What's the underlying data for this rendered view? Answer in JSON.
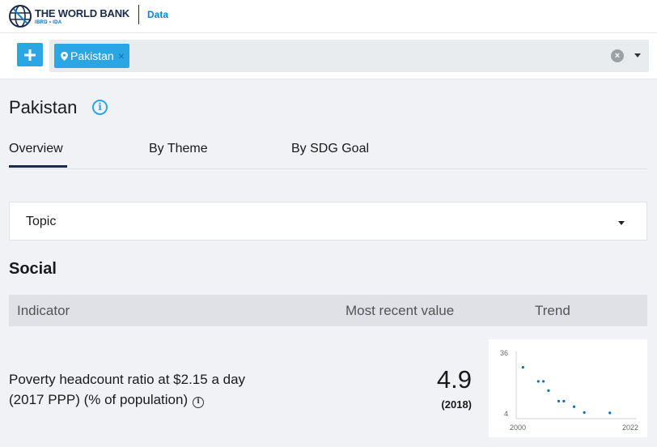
{
  "header": {
    "brand_name": "THE WORLD BANK",
    "brand_sub": "IBRD • IDA",
    "data_link": "Data"
  },
  "search": {
    "chip_label": "Pakistan",
    "chip_remove": "×",
    "clear": "×"
  },
  "page": {
    "title": "Pakistan",
    "info": "i"
  },
  "tabs": [
    {
      "label": "Overview",
      "active": true
    },
    {
      "label": "By Theme",
      "active": false
    },
    {
      "label": "By SDG Goal",
      "active": false
    }
  ],
  "topic": {
    "label": "Topic"
  },
  "section": {
    "heading": "Social"
  },
  "table": {
    "columns": [
      "Indicator",
      "Most recent value",
      "Trend"
    ],
    "rows": [
      {
        "indicator": "Poverty headcount ratio at $2.15 a day (2017 PPP) (% of population)",
        "value": "4.9",
        "year": "(2018)"
      }
    ]
  },
  "chart_data": {
    "type": "scatter",
    "x_min_label": "2000",
    "x_max_label": "2022",
    "y_max_label": "36",
    "y_min_label": "4",
    "xlim": [
      2000,
      2022
    ],
    "ylim": [
      4,
      36
    ],
    "points": [
      {
        "x": 2001,
        "y": 28.6
      },
      {
        "x": 2004,
        "y": 21.3
      },
      {
        "x": 2005,
        "y": 21.3
      },
      {
        "x": 2006,
        "y": 16.5
      },
      {
        "x": 2008,
        "y": 11.0
      },
      {
        "x": 2009,
        "y": 11.0
      },
      {
        "x": 2011,
        "y": 8.1
      },
      {
        "x": 2013,
        "y": 5.1
      },
      {
        "x": 2018,
        "y": 4.9
      }
    ],
    "point_color": "#0a6fb9"
  }
}
